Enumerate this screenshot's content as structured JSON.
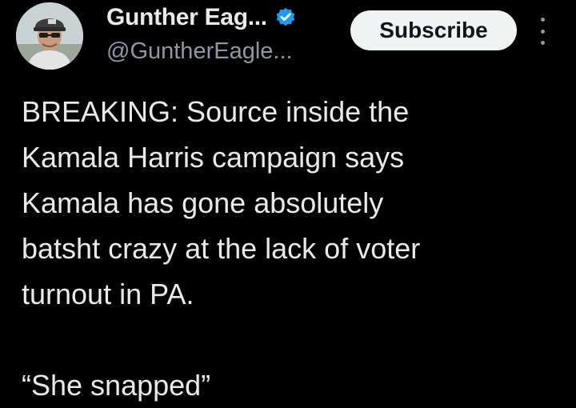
{
  "header": {
    "display_name": "Gunther Eag...",
    "handle": "@GuntherEagle...",
    "verified": true,
    "avatar_icon": "profile-photo-man-in-cap-and-sunglasses",
    "subscribe_label": "Subscribe",
    "more_icon": "more-vertical-icon"
  },
  "tweet": {
    "lines": [
      "BREAKING:  Source inside the",
      "Kamala Harris campaign says",
      "Kamala has gone absolutely",
      "batsht crazy at the lack of voter",
      "turnout in PA."
    ],
    "quote": "“She snapped”"
  },
  "colors": {
    "background": "#000000",
    "text": "#e7e9ea",
    "secondary_text": "#8b98a5",
    "verified_badge": "#1d9bf0",
    "subscribe_bg": "#eff3f4",
    "subscribe_text": "#0f1419"
  }
}
